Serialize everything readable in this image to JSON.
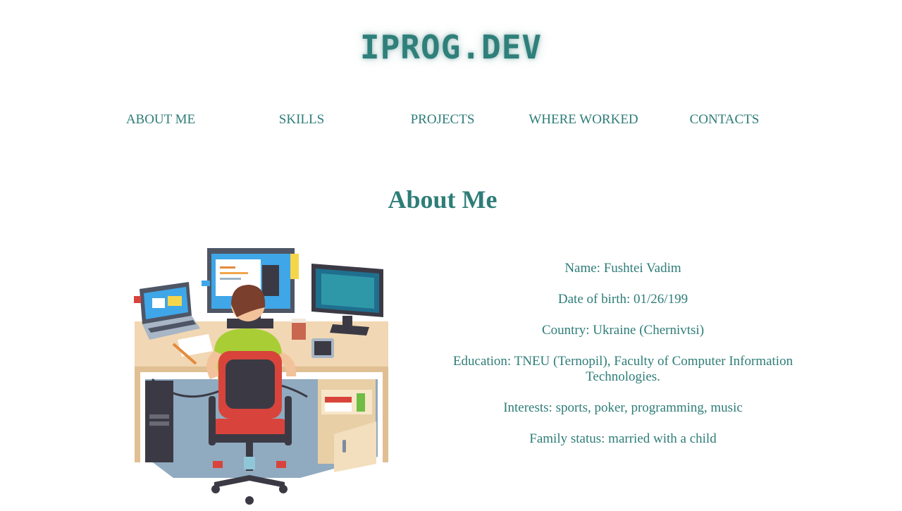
{
  "logo": "IPROG.DEV",
  "nav": [
    {
      "label": "ABOUT ME"
    },
    {
      "label": "SKILLS"
    },
    {
      "label": "PROJECTS"
    },
    {
      "label": "WHERE WORKED"
    },
    {
      "label": "CONTACTS"
    }
  ],
  "section_title": "About Me",
  "info": [
    "Name: Fushtei Vadim",
    "Date of birth: 01/26/199",
    "Country: Ukraine (Chernivtsi)",
    "Education: TNEU (Ternopil), Faculty of Computer Information Technologies.",
    "Interests: sports, poker, programming, music",
    "Family status: married with a child"
  ],
  "colors": {
    "accent": "#2e7d78",
    "background": "#ffffff"
  }
}
